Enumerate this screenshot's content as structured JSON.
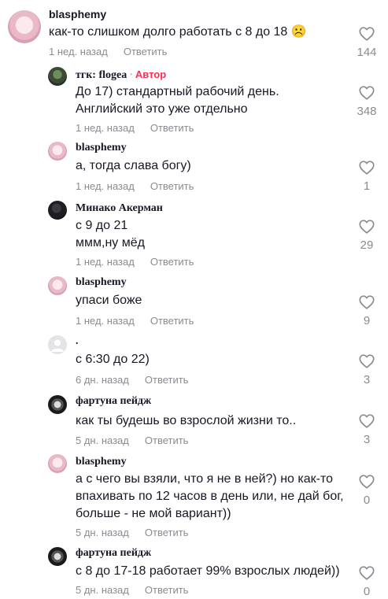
{
  "comments": [
    {
      "username": "blasphemy",
      "text": "как-то слишком долго работать с 8 до 18 ☹️",
      "time": "1 нед. назад",
      "reply": "Ответить",
      "likes": "144"
    },
    {
      "username": "тгк: flogea",
      "badge": "Автор",
      "text": "До 17) стандартный рабочий день.\nАнглийский это уже отдельно",
      "time": "1 нед. назад",
      "reply": "Ответить",
      "likes": "348"
    },
    {
      "username": "blasphemy",
      "text": "а, тогда слава богу)",
      "time": "1 нед. назад",
      "reply": "Ответить",
      "likes": "1"
    },
    {
      "username": "Минако Акерман",
      "text": "с 9 до 21\nммм,ну мёд",
      "time": "1 нед. назад",
      "reply": "Ответить",
      "likes": "29"
    },
    {
      "username": "blasphemy",
      "text": "упаси боже",
      "time": "1 нед. назад",
      "reply": "Ответить",
      "likes": "9"
    },
    {
      "username": ".",
      "text": "с 6:30 до 22)",
      "time": "6 дн. назад",
      "reply": "Ответить",
      "likes": "3"
    },
    {
      "username": "фартуна пейдж",
      "text": "как ты будешь во взрослой жизни то..",
      "time": "5 дн. назад",
      "reply": "Ответить",
      "likes": "3"
    },
    {
      "username": "blasphemy",
      "text": "а с чего вы взяли, что я не в ней?) но как-то\nвпахивать по 12 часов в день или, не дай бог,\nбольше - не мой вариант))",
      "time": "5 дн. назад",
      "reply": "Ответить",
      "likes": "0"
    },
    {
      "username": "фартуна пейдж",
      "text": "с 8 до 17-18 работает 99% взрослых людей))",
      "time": "5 дн. назад",
      "reply": "Ответить",
      "likes": "0"
    }
  ],
  "colors": {
    "meta": "#8a8b91",
    "author": "#fe2c55",
    "text": "#161823"
  }
}
